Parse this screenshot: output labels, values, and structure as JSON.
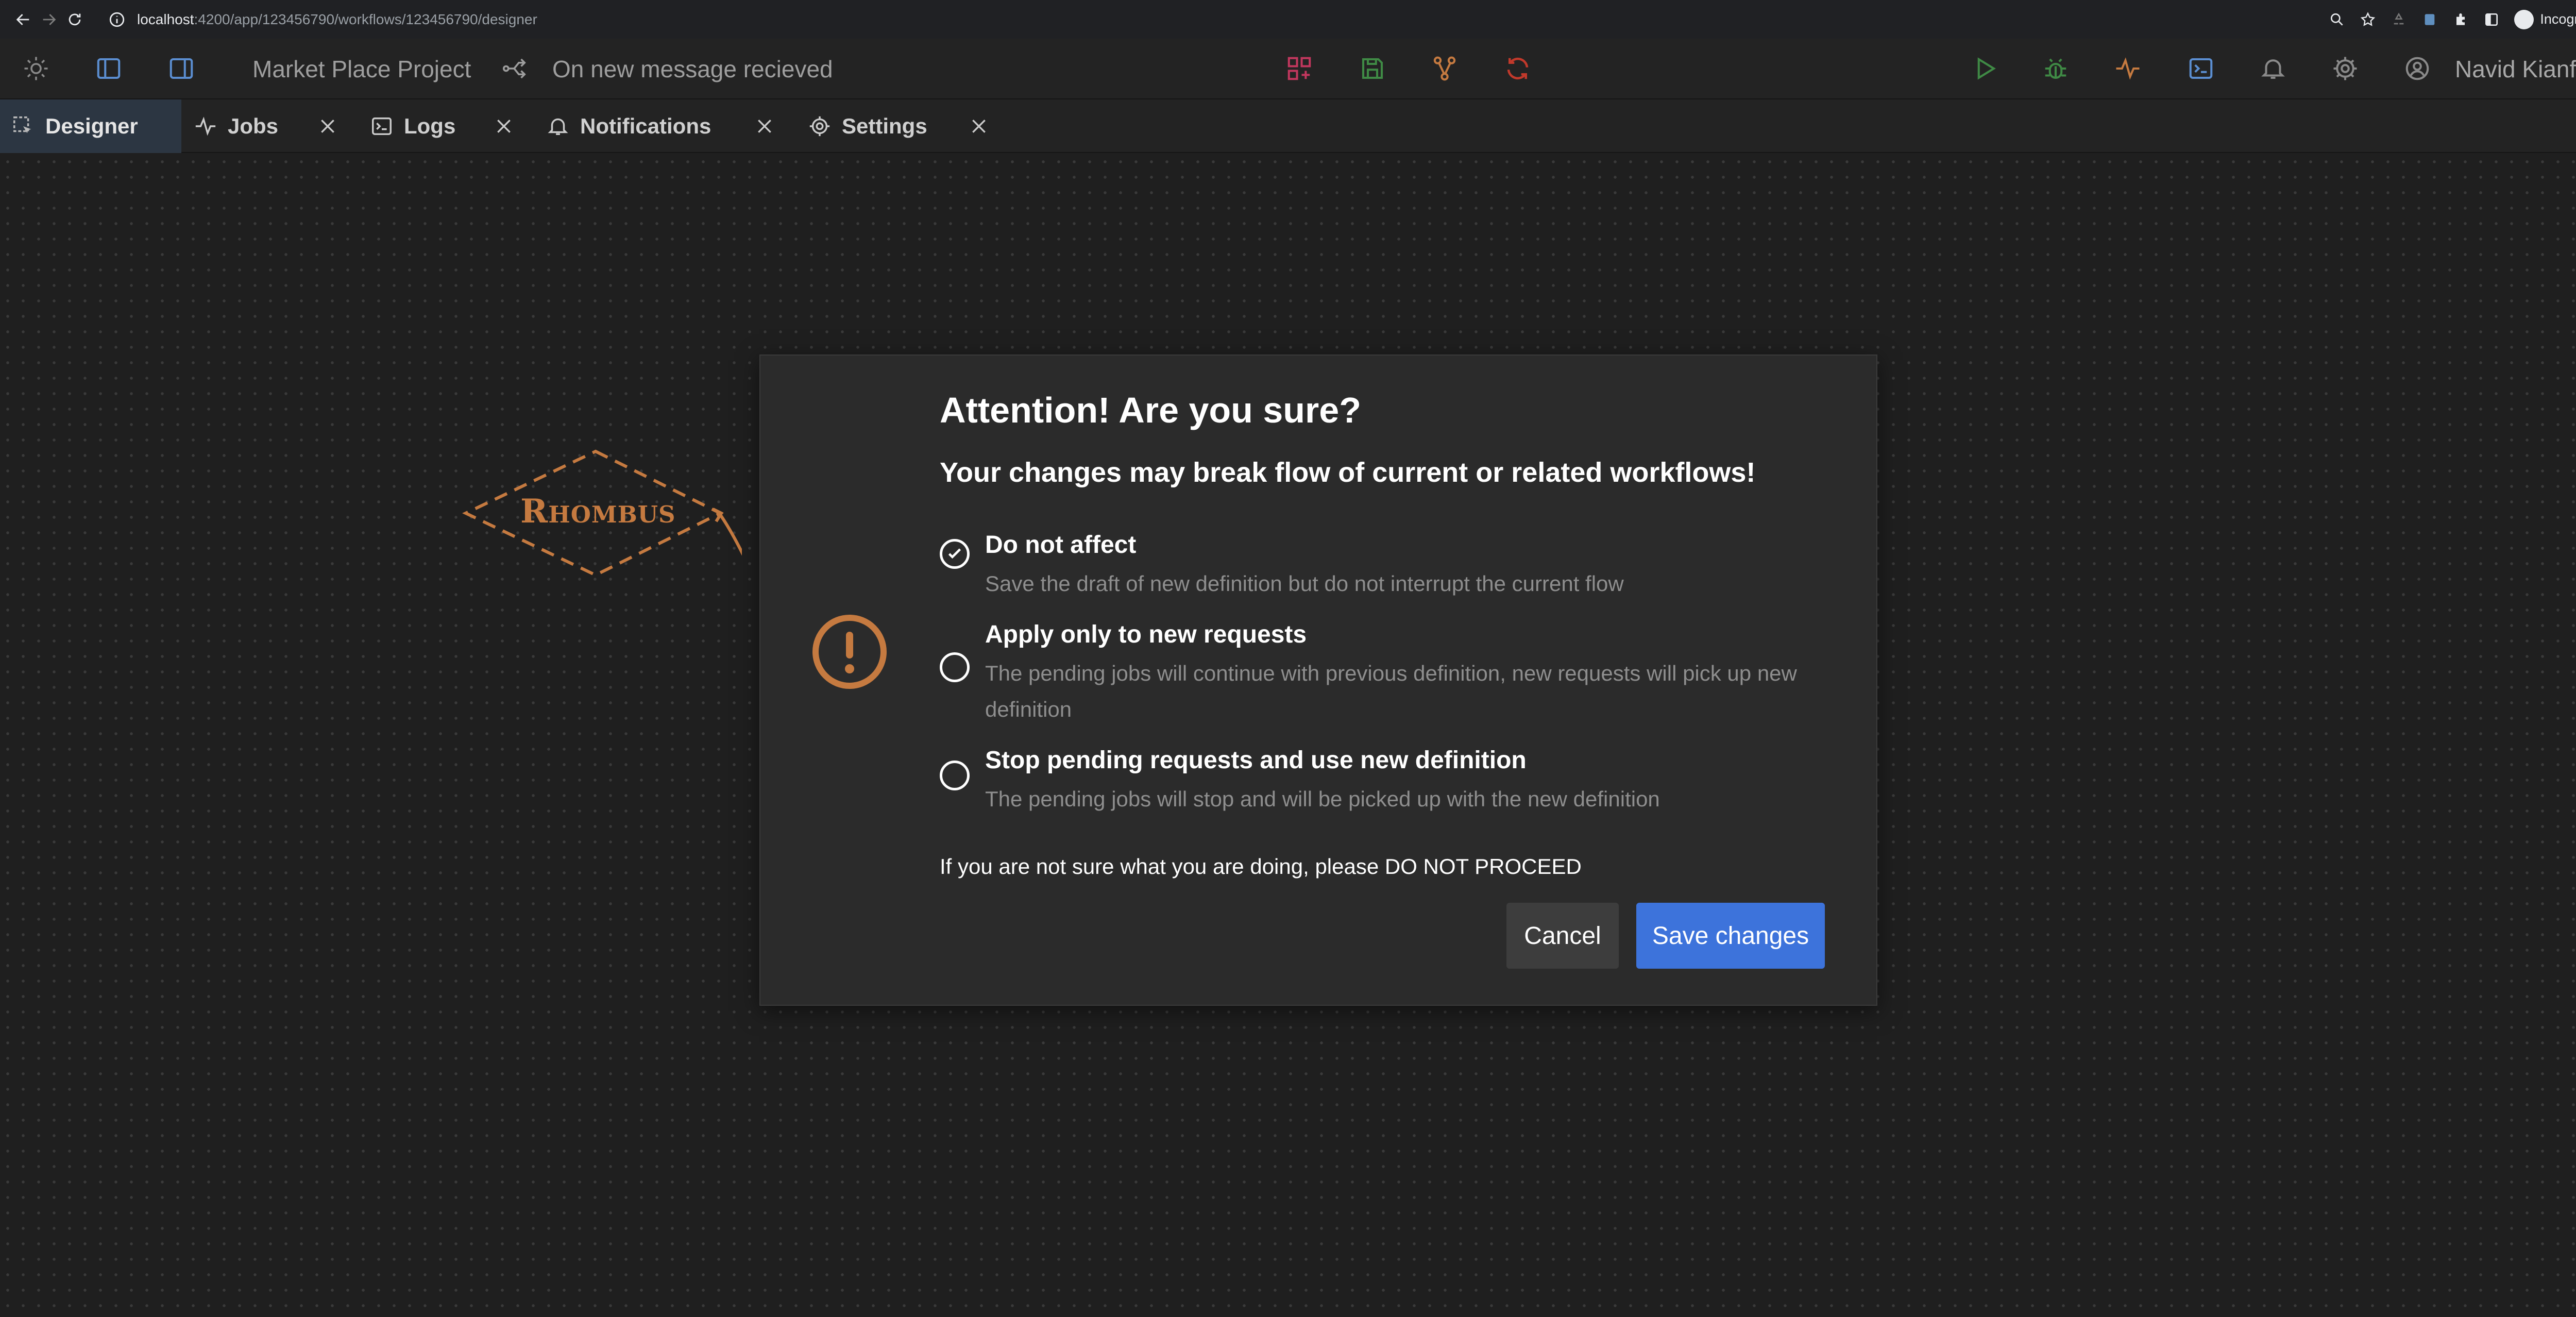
{
  "browser": {
    "url_host": "localhost",
    "url_path": ":4200/app/123456790/workflows/123456790/designer",
    "profile_label": "Incognito"
  },
  "header": {
    "project_title": "Market Place Project",
    "trigger_label": "On new message recieved",
    "user_name": "Navid Kianfar"
  },
  "tabs": [
    {
      "label": "Designer",
      "icon": "designer-icon",
      "active": true
    },
    {
      "label": "Jobs",
      "icon": "activity-icon"
    },
    {
      "label": "Logs",
      "icon": "terminal-icon"
    },
    {
      "label": "Notifications",
      "icon": "bell-icon"
    },
    {
      "label": "Settings",
      "icon": "gear-icon"
    }
  ],
  "canvas": {
    "node_label": "Rhombus"
  },
  "modal": {
    "title": "Attention! Are you sure?",
    "subtitle": "Your changes may break flow of current or related workflows!",
    "options": [
      {
        "label": "Do not affect",
        "description": "Save the draft of new definition but do not interrupt the current flow",
        "selected": true
      },
      {
        "label": "Apply only to new requests",
        "description": "The pending jobs will continue with previous definition, new requests will pick up new definition",
        "selected": false
      },
      {
        "label": "Stop pending requests and use new definition",
        "description": "The pending jobs will stop and will be picked up with the new definition",
        "selected": false
      }
    ],
    "note": "If you are not sure what you are doing, please DO NOT PROCEED",
    "cancel_label": "Cancel",
    "save_label": "Save changes"
  },
  "colors": {
    "accent_orange": "#c57a40",
    "primary_blue": "#3d73db",
    "pink": "#c2375e",
    "green": "#3f8a45"
  }
}
